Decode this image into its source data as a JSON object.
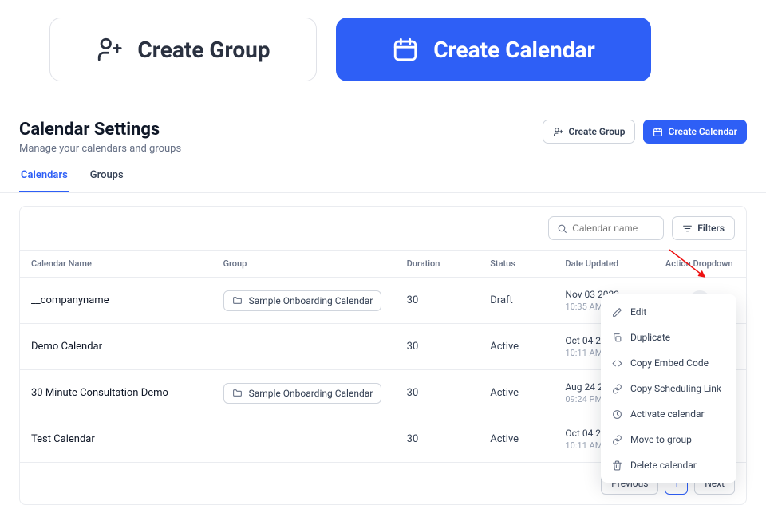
{
  "top_buttons": {
    "create_group": "Create Group",
    "create_calendar": "Create Calendar"
  },
  "header": {
    "title": "Calendar Settings",
    "subtitle": "Manage your calendars and groups",
    "actions": {
      "create_group": "Create Group",
      "create_calendar": "Create Calendar"
    }
  },
  "tabs": [
    {
      "label": "Calendars",
      "active": true
    },
    {
      "label": "Groups",
      "active": false
    }
  ],
  "search": {
    "placeholder": "Calendar name"
  },
  "filters_label": "Filters",
  "columns": {
    "name": "Calendar Name",
    "group": "Group",
    "duration": "Duration",
    "status": "Status",
    "updated": "Date Updated",
    "action": "Action Dropdown"
  },
  "rows": [
    {
      "name": "__companyname",
      "group": "Sample Onboarding Calendar",
      "duration": "30",
      "status": "Draft",
      "date": "Nov 03 2022",
      "time": "10:35 AM"
    },
    {
      "name": "Demo Calendar",
      "group": "",
      "duration": "30",
      "status": "Active",
      "date": "Oct 04 2021",
      "time": "10:11 AM"
    },
    {
      "name": "30 Minute Consultation Demo",
      "group": "Sample Onboarding Calendar",
      "duration": "30",
      "status": "Active",
      "date": "Aug 24 2022",
      "time": "09:24 PM"
    },
    {
      "name": "Test Calendar",
      "group": "",
      "duration": "30",
      "status": "Active",
      "date": "Oct 04 2021",
      "time": "10:11 AM"
    }
  ],
  "dropdown": {
    "edit": "Edit",
    "duplicate": "Duplicate",
    "copy_embed": "Copy Embed Code",
    "copy_link": "Copy Scheduling Link",
    "activate": "Activate calendar",
    "move": "Move to group",
    "delete": "Delete calendar"
  },
  "pagination": {
    "prev": "Previous",
    "page": "1",
    "next": "Next"
  }
}
